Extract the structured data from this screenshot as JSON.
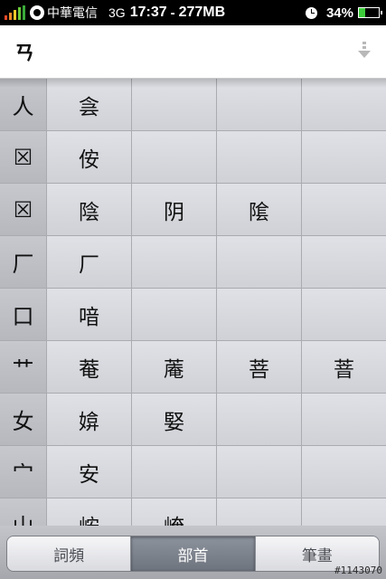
{
  "status_bar": {
    "carrier": "中華電信",
    "network": "3G",
    "time": "17:37",
    "separator": "-",
    "memory": "277MB",
    "battery_percent": "34%",
    "battery_level": 0.34,
    "icons": [
      "signal-icon",
      "carrier-icon",
      "alarm-icon",
      "battery-icon"
    ]
  },
  "input": {
    "composition": "ㄢ",
    "scroll_icon": "chevron-down-icon"
  },
  "grid": {
    "rows": [
      {
        "radical": "人",
        "candidates": [
          "侌",
          "",
          "",
          ""
        ]
      },
      {
        "radical": "☒",
        "candidates": [
          "侒",
          "",
          "",
          ""
        ]
      },
      {
        "radical": "☒",
        "candidates": [
          "陰",
          "阴",
          "隂",
          ""
        ]
      },
      {
        "radical": "厂",
        "candidates": [
          "厂",
          "",
          "",
          ""
        ]
      },
      {
        "radical": "口",
        "candidates": [
          "喑",
          "",
          "",
          ""
        ]
      },
      {
        "radical": "艹",
        "candidates": [
          "菴",
          "蓭",
          "菩",
          "萻"
        ]
      },
      {
        "radical": "女",
        "candidates": [
          "媕",
          "婜",
          "",
          ""
        ]
      },
      {
        "radical": "宀",
        "candidates": [
          "安",
          "",
          "",
          ""
        ]
      },
      {
        "radical": "山",
        "candidates": [
          "峖",
          "崦",
          "",
          ""
        ]
      }
    ]
  },
  "tabs": [
    {
      "label": "詞頻",
      "active": false
    },
    {
      "label": "部首",
      "active": true
    },
    {
      "label": "筆畫",
      "active": false
    }
  ],
  "watermark": "#1143070"
}
